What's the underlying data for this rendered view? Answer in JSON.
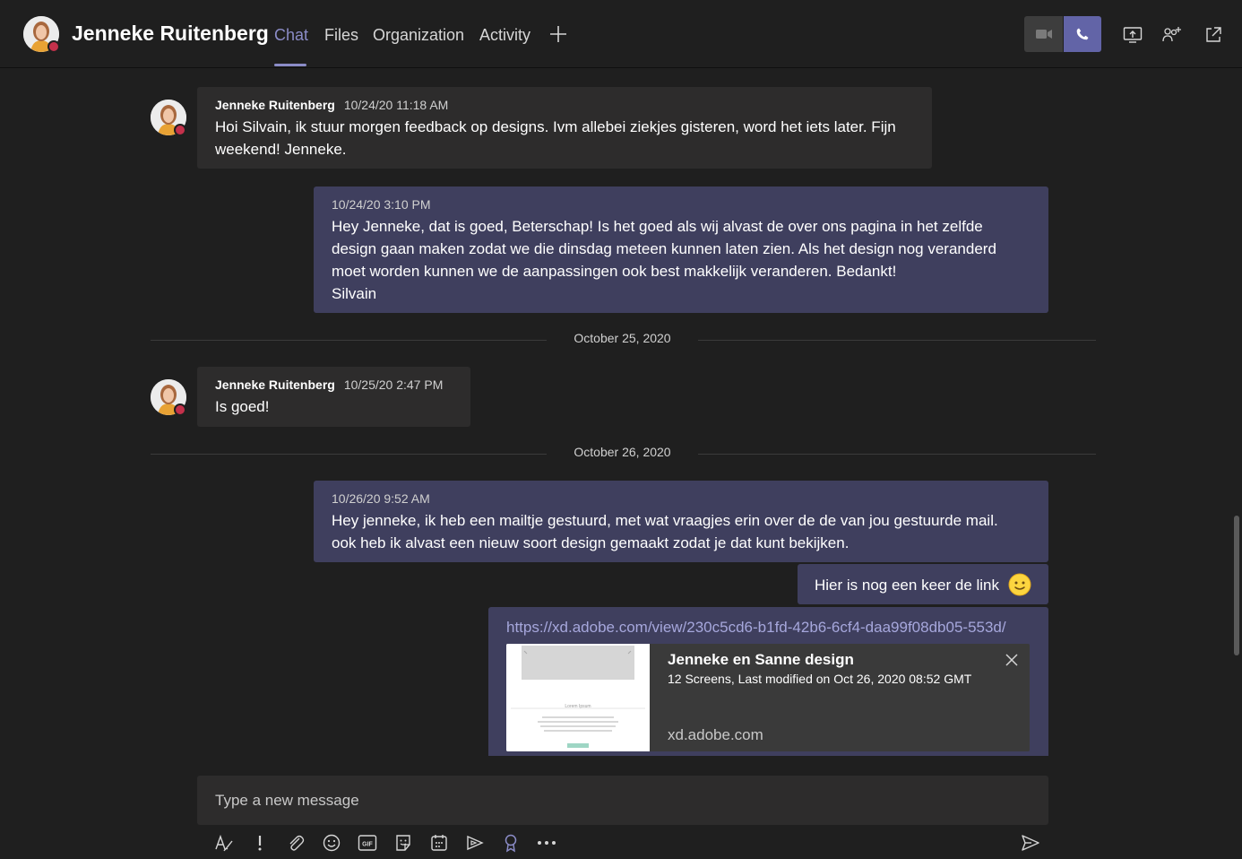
{
  "header": {
    "contact_name": "Jenneke Ruitenberg",
    "tabs": [
      {
        "label": "Chat",
        "active": true
      },
      {
        "label": "Files"
      },
      {
        "label": "Organization"
      },
      {
        "label": "Activity"
      }
    ],
    "add_tab_icon": "plus-icon",
    "actions": [
      "video-call-icon",
      "audio-call-icon",
      "share-screen-icon",
      "add-people-icon",
      "pop-out-icon"
    ],
    "accent_color": "#6264a7",
    "presence_color": "#c4314b"
  },
  "messages": [
    {
      "direction": "incoming",
      "author": "Jenneke Ruitenberg",
      "timestamp": "10/24/20 11:18 AM",
      "lines": [
        "Hoi Silvain, ik stuur morgen feedback op designs. Ivm allebei ziekjes gisteren, word het iets later. Fijn",
        "weekend! Jenneke."
      ]
    },
    {
      "direction": "outgoing",
      "timestamp": "10/24/20 3:10 PM",
      "lines": [
        "Hey Jenneke, dat is goed, Beterschap! Is het goed als wij alvast de over ons pagina in het zelfde",
        "design gaan maken zodat we die dinsdag meteen kunnen laten zien. Als het design nog veranderd",
        "moet worden kunnen we de aanpassingen ook best makkelijk veranderen. Bedankt!",
        "Silvain"
      ]
    },
    {
      "type": "date-divider",
      "label": "October 25, 2020"
    },
    {
      "direction": "incoming",
      "author": "Jenneke Ruitenberg",
      "timestamp": "10/25/20 2:47 PM",
      "lines": [
        "Is goed!"
      ]
    },
    {
      "type": "date-divider",
      "label": "October 26, 2020"
    },
    {
      "direction": "outgoing",
      "timestamp": "10/26/20 9:52 AM",
      "lines": [
        "Hey jenneke, ik heb een mailtje gestuurd, met wat vraagjes erin over de de van jou gestuurde mail.",
        "ook heb ik alvast een nieuw soort design gemaakt zodat je dat kunt bekijken."
      ]
    },
    {
      "direction": "outgoing",
      "text": "Hier is nog een keer de link",
      "emoji": "smile"
    },
    {
      "direction": "outgoing",
      "link": "https://xd.adobe.com/view/230c5cd6-b1fd-42b6-6cf4-daa99f08db05-553d/",
      "card": {
        "title": "Jenneke en Sanne design",
        "subtitle": "12 Screens, Last modified on Oct 26, 2020 08:52 GMT",
        "domain": "xd.adobe.com",
        "thumb_heading": "Lorem Ipsum"
      }
    }
  ],
  "compose": {
    "placeholder": "Type a new message",
    "tools": [
      "format-icon",
      "important-icon",
      "attach-icon",
      "emoji-icon",
      "gif-icon",
      "sticker-icon",
      "schedule-meeting-icon",
      "stream-icon",
      "praise-icon",
      "more-icon"
    ],
    "send_icon": "send-icon"
  }
}
